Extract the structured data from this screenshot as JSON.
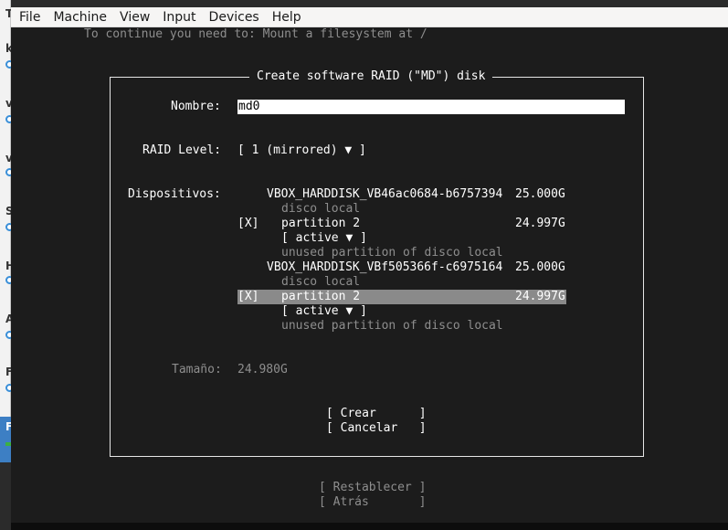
{
  "host_sidebar": {
    "letters": [
      "T",
      "k",
      "v",
      "v",
      "S",
      "H",
      "A",
      "F",
      "F"
    ]
  },
  "menubar": {
    "items": [
      "File",
      "Machine",
      "View",
      "Input",
      "Devices",
      "Help"
    ]
  },
  "console": {
    "top_message": "To continue you need to: Mount a filesystem at /",
    "dialog": {
      "title": "Create software RAID (\"MD\") disk",
      "name_label": "Nombre:",
      "name_value": "md0",
      "raid_level_label": "RAID Level:",
      "raid_level_value": "[ 1 (mirrored) ▼ ]",
      "devices_label": "Dispositivos:",
      "disks": [
        {
          "name": "VBOX_HARDDISK_VB46ac0684-b6757394",
          "size": "25.000G",
          "subtitle": "disco local",
          "partition": {
            "checkbox": "[X]",
            "label": "partition 2",
            "size": "24.997G",
            "role": "[ active ▼ ]",
            "note": "unused partition of disco local",
            "selected": false
          }
        },
        {
          "name": "VBOX_HARDDISK_VBf505366f-c6975164",
          "size": "25.000G",
          "subtitle": "disco local",
          "partition": {
            "checkbox": "[X]",
            "label": "partition 2",
            "size": "24.997G",
            "role": "[ active ▼ ]",
            "note": "unused partition of disco local",
            "selected": true
          }
        }
      ],
      "size_label": "Tamaño:",
      "size_value": "24.980G",
      "buttons": {
        "create": "[ Crear      ]",
        "cancel": "[ Cancelar   ]"
      }
    },
    "footer_buttons": {
      "reset": "[ Restablecer ]",
      "back": "[ Atrás       ]"
    }
  },
  "colors": {
    "console_bg": "#1c1c1c",
    "selection_bg": "#8a8a8a",
    "dim_text": "#8e8e8e",
    "menubar_bg": "#f6f5f4"
  }
}
